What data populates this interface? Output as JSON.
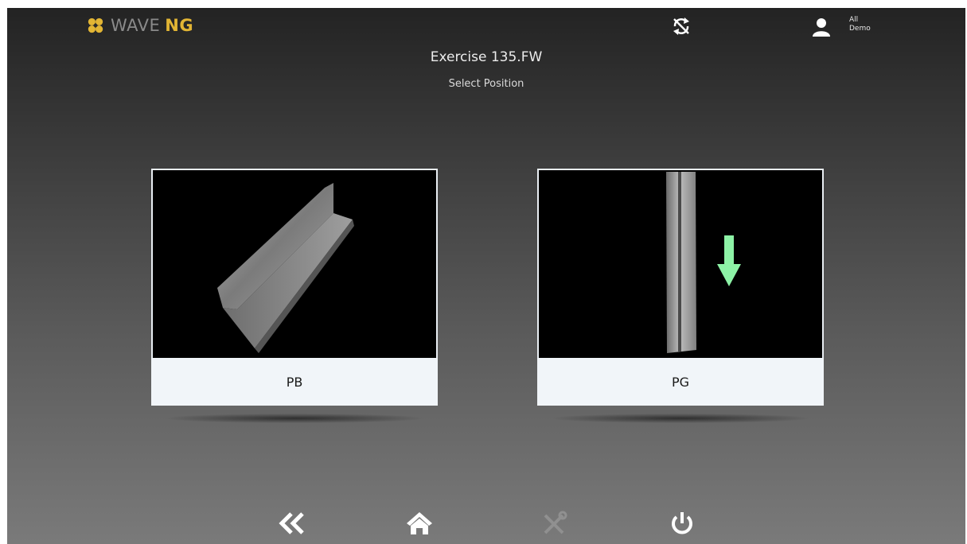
{
  "header": {
    "logo_text": "WAVE",
    "logo_accent": "NG",
    "user_line1": "All",
    "user_line2": "Demo"
  },
  "main": {
    "title": "Exercise 135.FW",
    "subtitle": "Select Position"
  },
  "positions": [
    {
      "label": "PB"
    },
    {
      "label": "PG"
    }
  ],
  "icons": {
    "logo": "flower-logo-icon",
    "sync": "sync-disabled-icon",
    "user": "user-icon",
    "back": "double-chevron-left-icon",
    "home": "home-icon",
    "tools": "tools-icon",
    "power": "power-icon",
    "arrow": "arrow-down-icon"
  },
  "colors": {
    "brand_accent": "#e2b534",
    "arrow_green": "#8df2a6",
    "card_label_bg": "#f1f5f9"
  }
}
